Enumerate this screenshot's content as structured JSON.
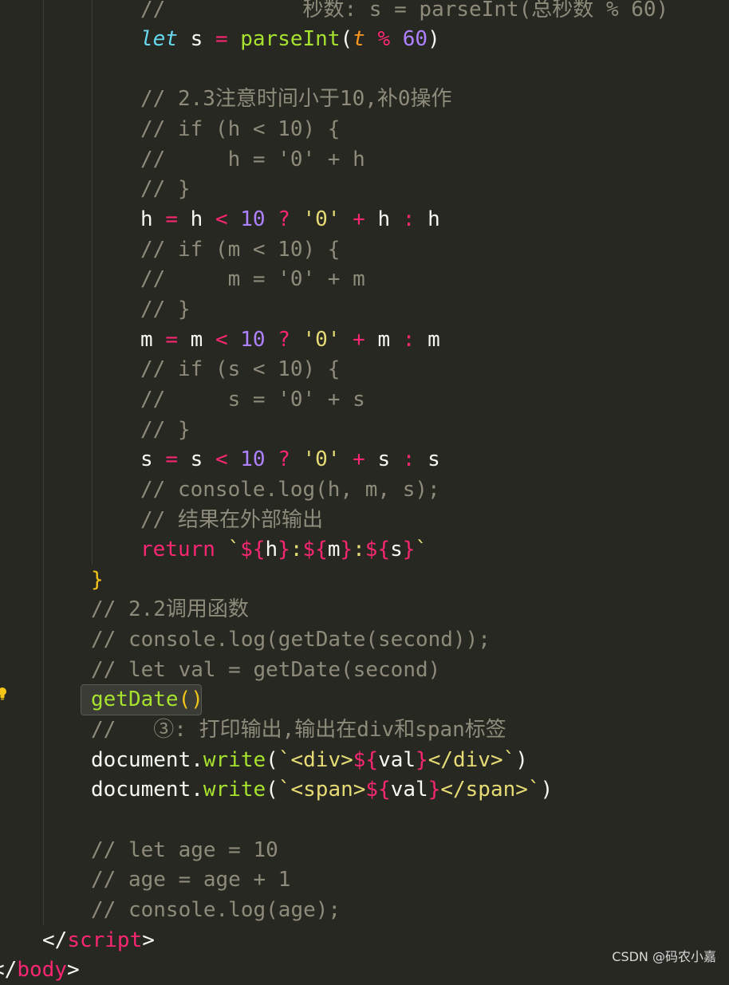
{
  "editor": {
    "lines": [
      {
        "id": "l1",
        "segs": [
          [
            "c",
            "//           秒数: s = parseInt(总秒数 % 60)"
          ]
        ]
      },
      {
        "id": "l2",
        "segs": [
          [
            "t",
            "let"
          ],
          [
            "p",
            " s "
          ],
          [
            "k",
            "="
          ],
          [
            "p",
            " "
          ],
          [
            "f",
            "parseInt"
          ],
          [
            "p",
            "("
          ],
          [
            "o",
            "t"
          ],
          [
            "p",
            " "
          ],
          [
            "k",
            "%"
          ],
          [
            "p",
            " "
          ],
          [
            "n",
            "60"
          ],
          [
            "p",
            ")"
          ]
        ]
      },
      {
        "id": "l3",
        "segs": []
      },
      {
        "id": "l4",
        "segs": [
          [
            "c",
            "// 2.3注意时间小于10,补0操作"
          ]
        ]
      },
      {
        "id": "l5",
        "segs": [
          [
            "c",
            "// if (h < 10) {"
          ]
        ]
      },
      {
        "id": "l6",
        "segs": [
          [
            "c",
            "//     h = '0' + h"
          ]
        ]
      },
      {
        "id": "l7",
        "segs": [
          [
            "c",
            "// }"
          ]
        ]
      },
      {
        "id": "l8",
        "segs": [
          [
            "p",
            "h "
          ],
          [
            "k",
            "="
          ],
          [
            "p",
            " h "
          ],
          [
            "k",
            "<"
          ],
          [
            "p",
            " "
          ],
          [
            "n",
            "10"
          ],
          [
            "p",
            " "
          ],
          [
            "k",
            "?"
          ],
          [
            "p",
            " "
          ],
          [
            "s",
            "'0'"
          ],
          [
            "p",
            " "
          ],
          [
            "k",
            "+"
          ],
          [
            "p",
            " h "
          ],
          [
            "k",
            ":"
          ],
          [
            "p",
            " h"
          ]
        ]
      },
      {
        "id": "l9",
        "segs": [
          [
            "c",
            "// if (m < 10) {"
          ]
        ]
      },
      {
        "id": "l10",
        "segs": [
          [
            "c",
            "//     m = '0' + m"
          ]
        ]
      },
      {
        "id": "l11",
        "segs": [
          [
            "c",
            "// }"
          ]
        ]
      },
      {
        "id": "l12",
        "segs": [
          [
            "p",
            "m "
          ],
          [
            "k",
            "="
          ],
          [
            "p",
            " m "
          ],
          [
            "k",
            "<"
          ],
          [
            "p",
            " "
          ],
          [
            "n",
            "10"
          ],
          [
            "p",
            " "
          ],
          [
            "k",
            "?"
          ],
          [
            "p",
            " "
          ],
          [
            "s",
            "'0'"
          ],
          [
            "p",
            " "
          ],
          [
            "k",
            "+"
          ],
          [
            "p",
            " m "
          ],
          [
            "k",
            ":"
          ],
          [
            "p",
            " m"
          ]
        ]
      },
      {
        "id": "l13",
        "segs": [
          [
            "c",
            "// if (s < 10) {"
          ]
        ]
      },
      {
        "id": "l14",
        "segs": [
          [
            "c",
            "//     s = '0' + s"
          ]
        ]
      },
      {
        "id": "l15",
        "segs": [
          [
            "c",
            "// }"
          ]
        ]
      },
      {
        "id": "l16",
        "segs": [
          [
            "p",
            "s "
          ],
          [
            "k",
            "="
          ],
          [
            "p",
            " s "
          ],
          [
            "k",
            "<"
          ],
          [
            "p",
            " "
          ],
          [
            "n",
            "10"
          ],
          [
            "p",
            " "
          ],
          [
            "k",
            "?"
          ],
          [
            "p",
            " "
          ],
          [
            "s",
            "'0'"
          ],
          [
            "p",
            " "
          ],
          [
            "k",
            "+"
          ],
          [
            "p",
            " s "
          ],
          [
            "k",
            ":"
          ],
          [
            "p",
            " s"
          ]
        ]
      },
      {
        "id": "l17",
        "segs": [
          [
            "c",
            "// console.log(h, m, s);"
          ]
        ]
      },
      {
        "id": "l18",
        "segs": [
          [
            "c",
            "// 结果在外部输出"
          ]
        ]
      },
      {
        "id": "l19",
        "segs": [
          [
            "k",
            "return"
          ],
          [
            "p",
            " "
          ],
          [
            "s",
            "`"
          ],
          [
            "k",
            "${"
          ],
          [
            "p",
            "h"
          ],
          [
            "k",
            "}"
          ],
          [
            "s",
            ":"
          ],
          [
            "k",
            "${"
          ],
          [
            "p",
            "m"
          ],
          [
            "k",
            "}"
          ],
          [
            "s",
            ":"
          ],
          [
            "k",
            "${"
          ],
          [
            "p",
            "s"
          ],
          [
            "k",
            "}"
          ],
          [
            "s",
            "`"
          ]
        ]
      },
      {
        "id": "l20",
        "segs": [
          [
            "b",
            "}"
          ]
        ]
      },
      {
        "id": "l21",
        "segs": [
          [
            "c",
            "// 2.2调用函数"
          ]
        ]
      },
      {
        "id": "l22",
        "segs": [
          [
            "c",
            "// console.log(getDate(second));"
          ]
        ]
      },
      {
        "id": "l23",
        "segs": [
          [
            "c",
            "// let val = getDate(second)"
          ]
        ]
      },
      {
        "id": "l24",
        "segs": [
          [
            "f",
            "getDate"
          ],
          [
            "b",
            "()"
          ]
        ]
      },
      {
        "id": "l25",
        "segs": [
          [
            "c",
            "//   ③: 打印输出,输出在div和span标签"
          ]
        ]
      },
      {
        "id": "l26",
        "segs": [
          [
            "p",
            "document."
          ],
          [
            "f",
            "write"
          ],
          [
            "p",
            "("
          ],
          [
            "s",
            "`<div>"
          ],
          [
            "k",
            "${"
          ],
          [
            "p",
            "val"
          ],
          [
            "k",
            "}"
          ],
          [
            "s",
            "</div>`"
          ],
          [
            "p",
            ")"
          ]
        ]
      },
      {
        "id": "l27",
        "segs": [
          [
            "p",
            "document."
          ],
          [
            "f",
            "write"
          ],
          [
            "p",
            "("
          ],
          [
            "s",
            "`<span>"
          ],
          [
            "k",
            "${"
          ],
          [
            "p",
            "val"
          ],
          [
            "k",
            "}"
          ],
          [
            "s",
            "</span>`"
          ],
          [
            "p",
            ")"
          ]
        ]
      },
      {
        "id": "l28",
        "segs": []
      },
      {
        "id": "l29",
        "segs": [
          [
            "c",
            "// let age = 10"
          ]
        ]
      },
      {
        "id": "l30",
        "segs": [
          [
            "c",
            "// age = age + 1"
          ]
        ]
      },
      {
        "id": "l31",
        "segs": [
          [
            "c",
            "// console.log(age);"
          ]
        ]
      },
      {
        "id": "l32",
        "segs": [
          [
            "p",
            "</"
          ],
          [
            "k",
            "script"
          ],
          [
            "p",
            ">"
          ]
        ]
      },
      {
        "id": "l33",
        "segs": [
          [
            "p",
            "</"
          ],
          [
            "k",
            "body"
          ],
          [
            "p",
            ">"
          ]
        ]
      }
    ]
  },
  "watermark": "CSDN @码农小嘉",
  "colors": {
    "background": "#272822",
    "comment": "#8f8b7b",
    "keyword": "#f92672",
    "number": "#ae81ff",
    "string": "#e6db74",
    "function": "#a6e22e",
    "storage": "#66d9ef",
    "param": "#fd971f",
    "bracket": "#f0c419"
  },
  "icons": [
    "lightbulb-icon"
  ]
}
